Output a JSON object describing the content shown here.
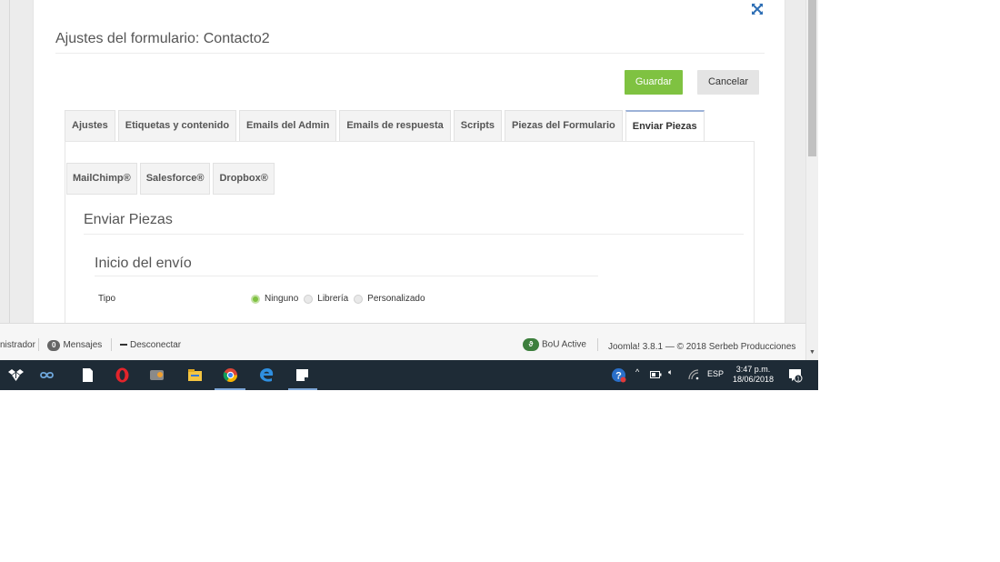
{
  "modal": {
    "title": "Ajustes del formulario: Contacto2",
    "save_label": "Guardar",
    "cancel_label": "Cancelar"
  },
  "tabs": [
    {
      "label": "Ajustes",
      "active": false
    },
    {
      "label": "Etiquetas y contenido",
      "active": false
    },
    {
      "label": "Emails del Admin",
      "active": false
    },
    {
      "label": "Emails de respuesta",
      "active": false
    },
    {
      "label": "Scripts",
      "active": false
    },
    {
      "label": "Piezas del Formulario",
      "active": false
    },
    {
      "label": "Enviar Piezas",
      "active": true
    }
  ],
  "subtabs": [
    {
      "label": "MailChimp®"
    },
    {
      "label": "Salesforce®"
    },
    {
      "label": "Dropbox®"
    }
  ],
  "section": {
    "title": "Enviar Piezas",
    "subtitle": "Inicio del envío",
    "field_label": "Tipo",
    "options": [
      {
        "label": "Ninguno",
        "checked": true
      },
      {
        "label": "Librería",
        "checked": false
      },
      {
        "label": "Personalizado",
        "checked": false
      }
    ]
  },
  "status_bar": {
    "user_fragment": "nistrador",
    "messages_count": "0",
    "messages_label": "Mensajes",
    "logout_label": "Desconectar",
    "bou_label": "BoU Active",
    "version_text": "Joomla! 3.8.1  —  © 2018 Serbeb Producciones"
  },
  "taskbar": {
    "language": "ESP",
    "time": "3:47 p.m.",
    "date": "18/06/2018",
    "notification_count": "1",
    "icons": [
      "dropbox-icon",
      "infinity-icon",
      "file-icon",
      "opera-icon",
      "game-icon",
      "file-explorer-icon",
      "chrome-icon",
      "edge-icon",
      "sticky-notes-icon"
    ]
  },
  "colors": {
    "accent_green": "#7fc241",
    "taskbar": "#1e2b36",
    "active_tab_border": "#9db2d8"
  }
}
